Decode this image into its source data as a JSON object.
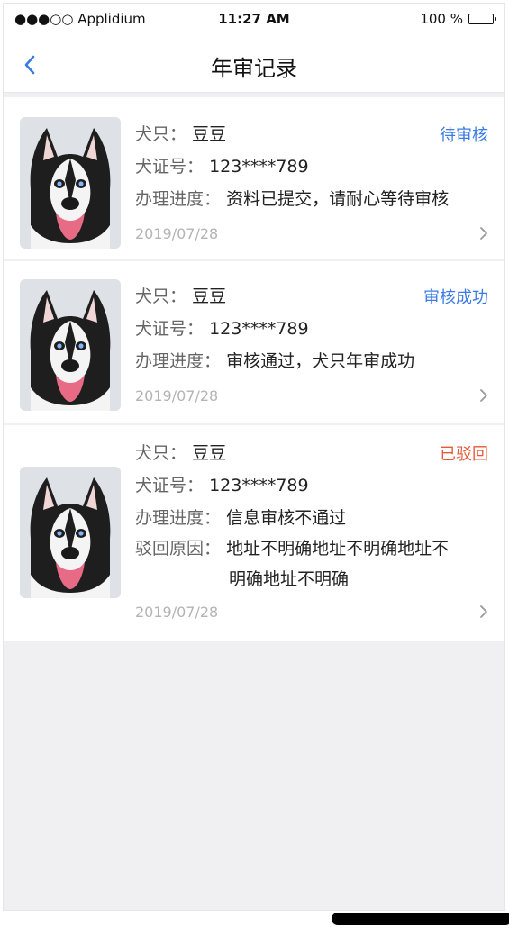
{
  "status_bar": {
    "carrier": "●●●○○ Applidium",
    "time": "11:27 AM",
    "battery": "100 %"
  },
  "nav": {
    "title": "年审记录"
  },
  "records": [
    {
      "dog_label": "犬只：",
      "dog_name": "豆豆",
      "cert_label": "犬证号：",
      "cert_no": "123****789",
      "progress_label": "办理进度：",
      "progress": "资料已提交，请耐心等待审核",
      "status": "待审核",
      "date": "2019/07/28"
    },
    {
      "dog_label": "犬只：",
      "dog_name": "豆豆",
      "cert_label": "犬证号：",
      "cert_no": "123****789",
      "progress_label": "办理进度：",
      "progress": "审核通过，犬只年审成功",
      "status": "审核成功",
      "date": "2019/07/28"
    },
    {
      "dog_label": "犬只：",
      "dog_name": "豆豆",
      "cert_label": "犬证号：",
      "cert_no": "123****789",
      "progress_label": "办理进度：",
      "progress": "信息审核不通过",
      "reason_label": "驳回原因：",
      "reason_line1": "地址不明确地址不明确地址不",
      "reason_line2": "明确地址不明确",
      "status": "已驳回",
      "date": "2019/07/28"
    }
  ],
  "colors": {
    "accent_blue": "#3a7be6",
    "reject_red": "#e6593a"
  }
}
